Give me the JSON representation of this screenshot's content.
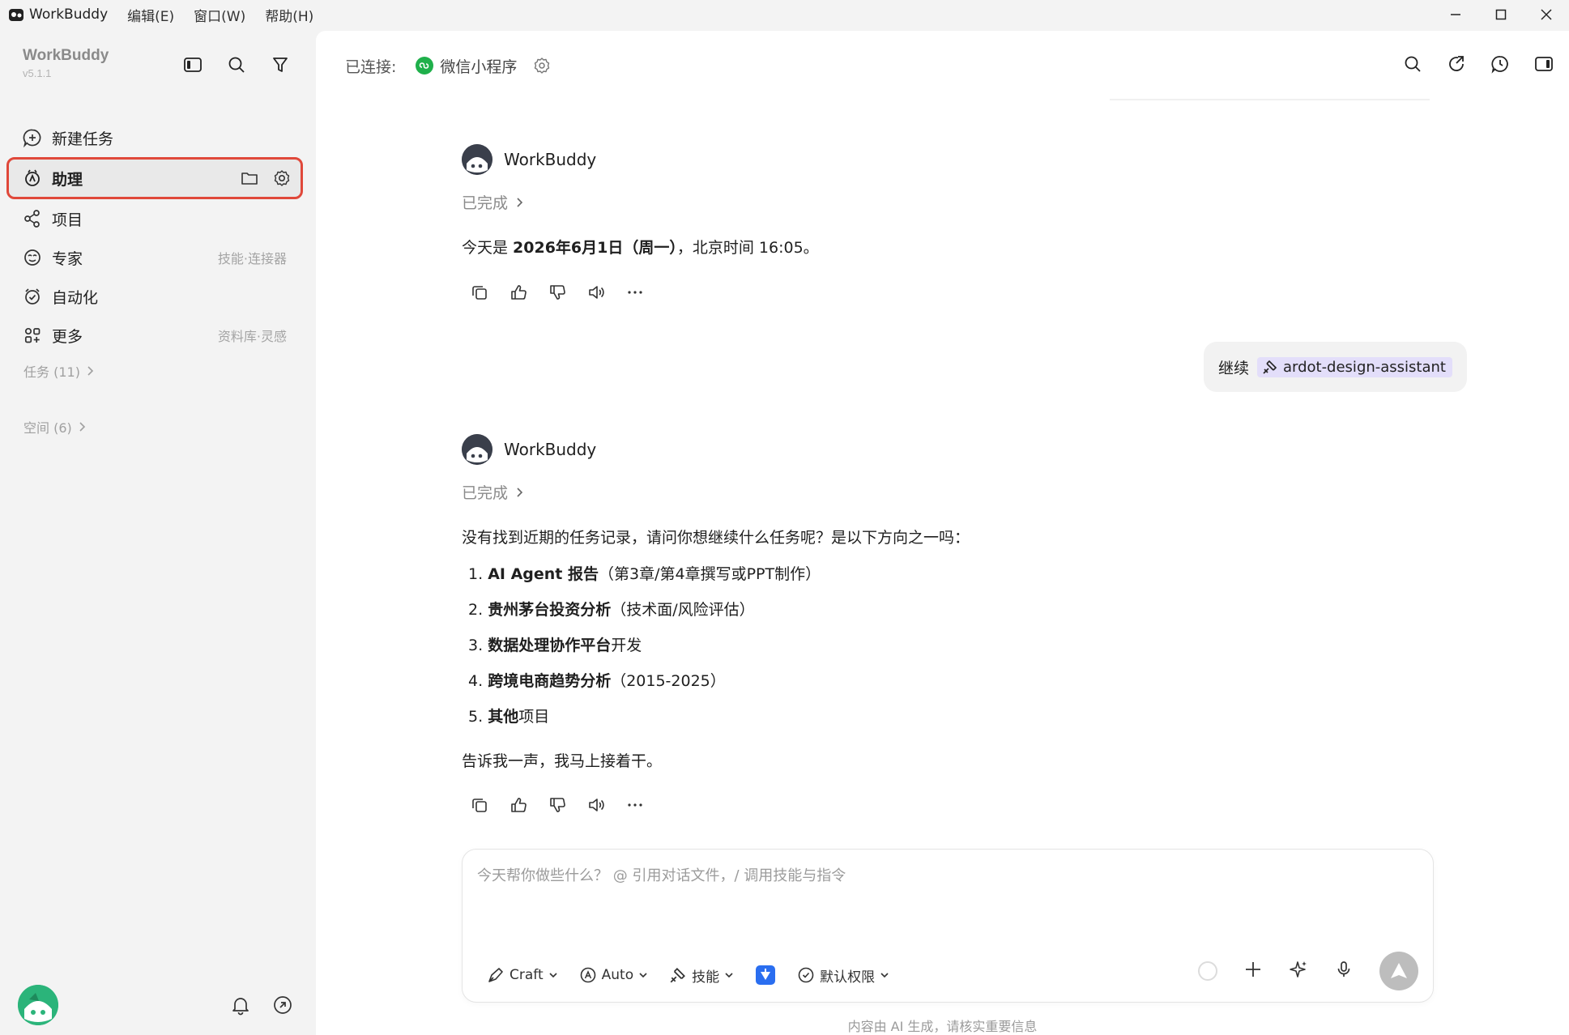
{
  "titlebar": {
    "app_name": "WorkBuddy",
    "menus": [
      "编辑(E)",
      "窗口(W)",
      "帮助(H)"
    ]
  },
  "sidebar": {
    "brand": "WorkBuddy",
    "version": "v5.1.1",
    "items": [
      {
        "label": "新建任务",
        "icon": "new-task-icon",
        "hint": ""
      },
      {
        "label": "助理",
        "icon": "assistant-icon",
        "hint": "",
        "active": true
      },
      {
        "label": "项目",
        "icon": "project-icon",
        "hint": ""
      },
      {
        "label": "专家",
        "icon": "expert-icon",
        "hint": "技能·连接器"
      },
      {
        "label": "自动化",
        "icon": "automation-icon",
        "hint": ""
      },
      {
        "label": "更多",
        "icon": "more-icon",
        "hint": "资料库·灵感"
      }
    ],
    "groups": [
      {
        "label": "任务 (11)"
      },
      {
        "label": "空间 (6)"
      }
    ]
  },
  "topbar": {
    "connected_label": "已连接:",
    "connector": "微信小程序"
  },
  "messages": {
    "m1": {
      "sender": "WorkBuddy",
      "status": "已完成",
      "text_prefix": "今天是 ",
      "text_bold": "2026年6月1日（周一）",
      "text_suffix": "，北京时间 16:05。"
    },
    "user": {
      "text": "继续",
      "skill": "ardot-design-assistant"
    },
    "m2": {
      "sender": "WorkBuddy",
      "status": "已完成",
      "intro": "没有找到近期的任务记录，请问你想继续什么任务呢？是以下方向之一吗：",
      "options": [
        {
          "num": "1.",
          "bold": "AI Agent 报告",
          "rest": "（第3章/第4章撰写或PPT制作）"
        },
        {
          "num": "2.",
          "bold": "贵州茅台投资分析",
          "rest": "（技术面/风险评估）"
        },
        {
          "num": "3.",
          "bold": "数据处理协作平台",
          "rest": "开发"
        },
        {
          "num": "4.",
          "bold": "跨境电商趋势分析",
          "rest": "（2015-2025）"
        },
        {
          "num": "5.",
          "bold": "其他",
          "rest": "项目"
        }
      ],
      "outro": "告诉我一声，我马上接着干。"
    }
  },
  "composer": {
    "placeholder": "今天帮你做些什么？ @ 引用对话文件，/ 调用技能与指令",
    "mode": "Craft",
    "model": "Auto",
    "skills": "技能",
    "permission": "默认权限"
  },
  "disclaimer": "内容由 AI 生成，请核实重要信息",
  "colors": {
    "accent_red": "#e0483a",
    "wechat_green": "#1fb04b",
    "skill_chip": "#e3defa"
  }
}
